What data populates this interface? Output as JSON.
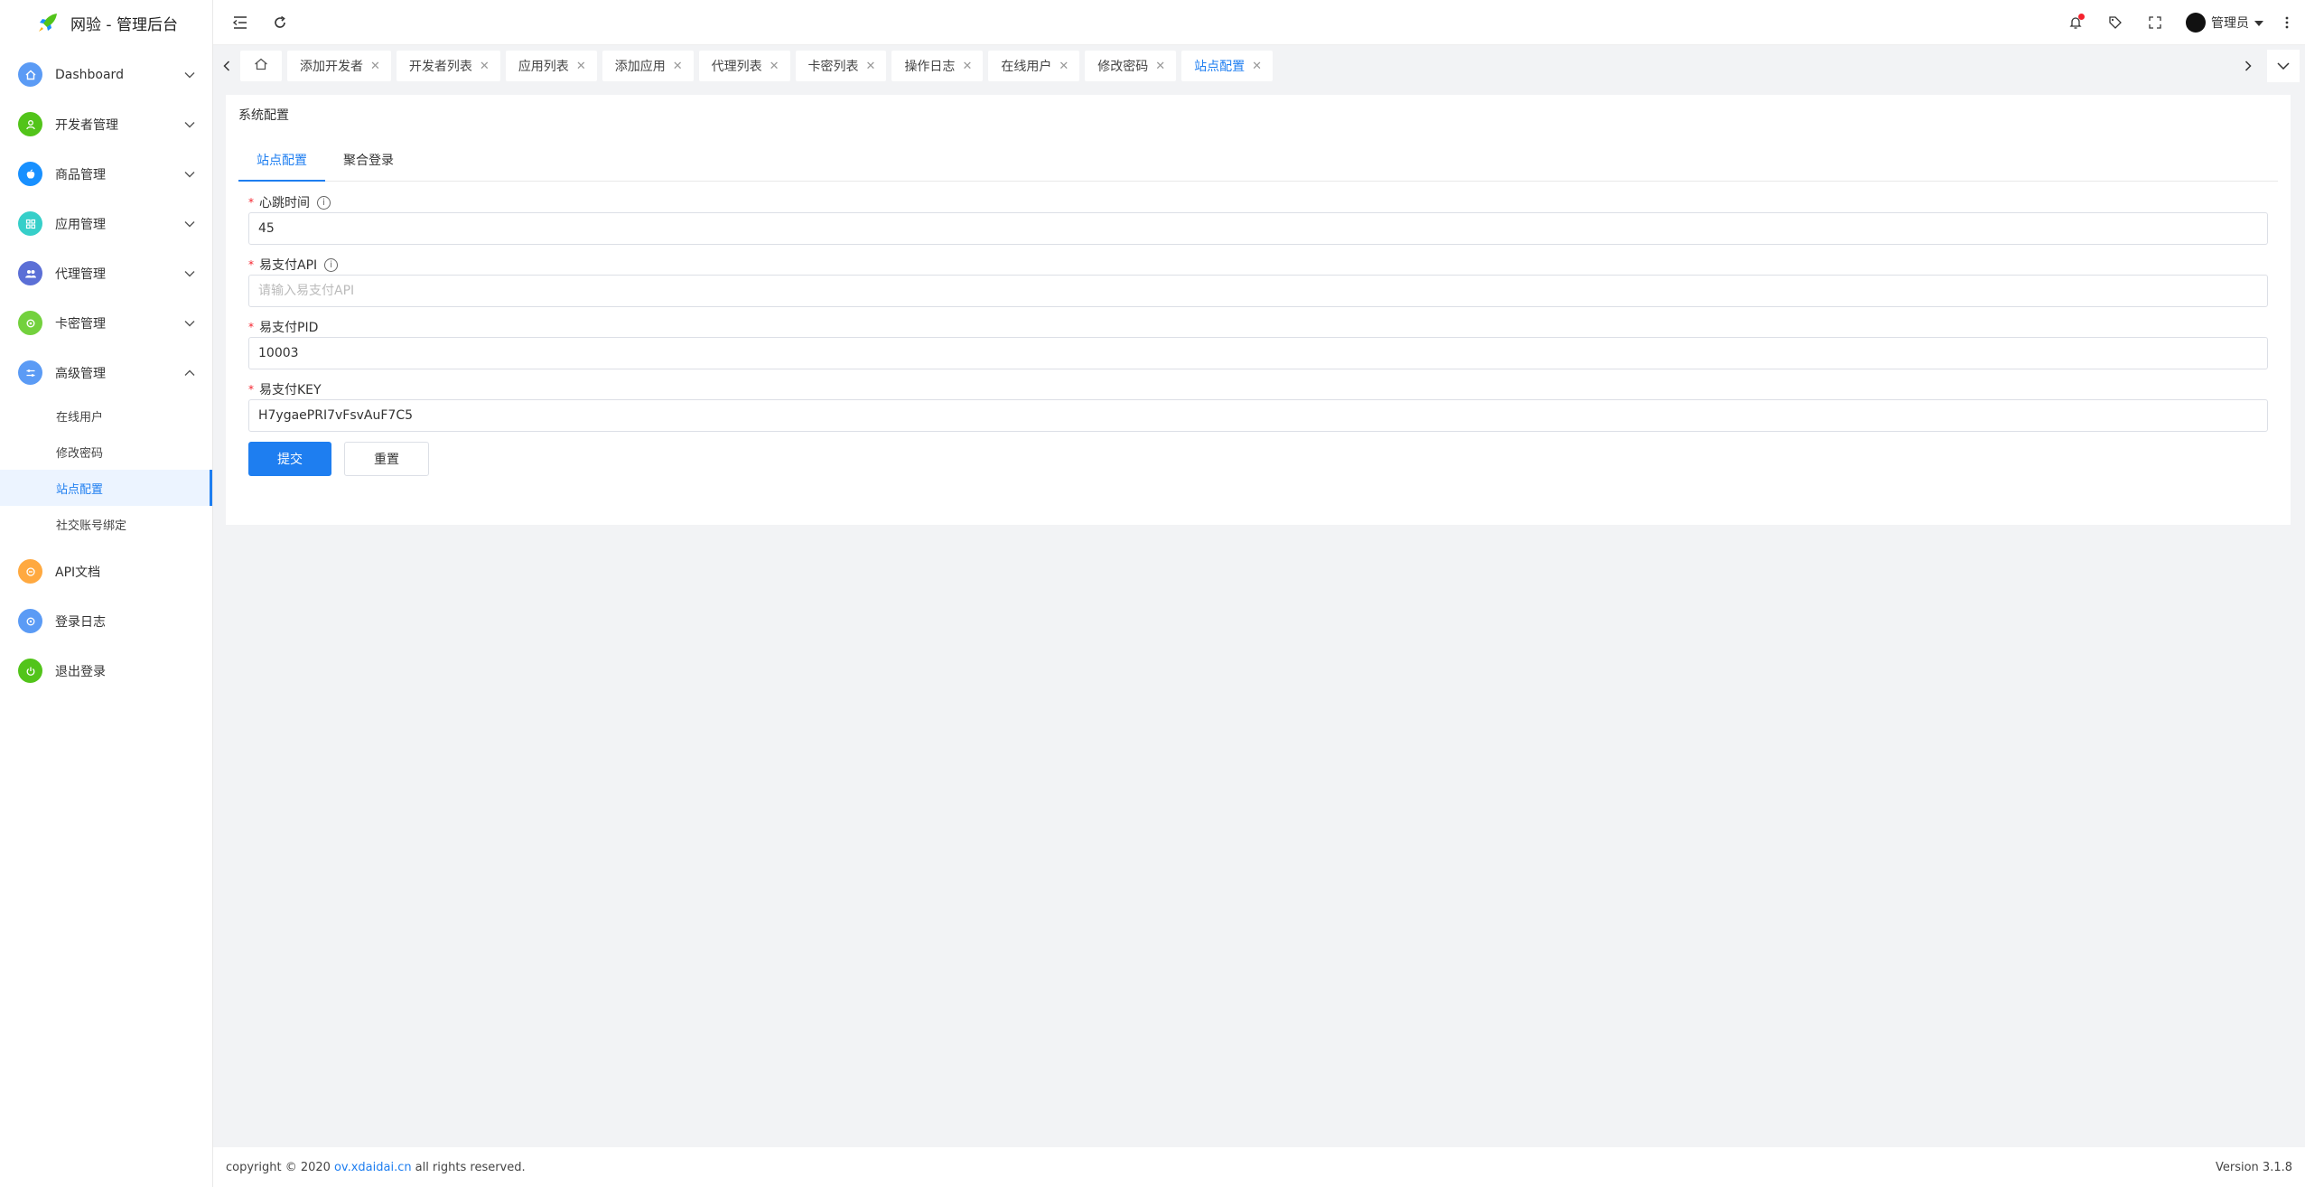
{
  "app": {
    "title": "网验 - 管理后台"
  },
  "colors": {
    "accent": "#1e7ef0",
    "danger": "#f5222d"
  },
  "sidebar": {
    "items": [
      {
        "label": "Dashboard",
        "icon": "home-icon",
        "color": "#5b9bf5"
      },
      {
        "label": "开发者管理",
        "icon": "user-icon",
        "color": "#52c41a"
      },
      {
        "label": "商品管理",
        "icon": "apple-icon",
        "color": "#1890ff"
      },
      {
        "label": "应用管理",
        "icon": "grid-icon",
        "color": "#36cfc9"
      },
      {
        "label": "代理管理",
        "icon": "users-icon",
        "color": "#5b6fd6"
      },
      {
        "label": "卡密管理",
        "icon": "gear-icon",
        "color": "#73d13d"
      },
      {
        "label": "高级管理",
        "icon": "sliders-icon",
        "color": "#5b9bf5"
      }
    ],
    "submenu": [
      "在线用户",
      "修改密码",
      "站点配置",
      "社交账号绑定"
    ],
    "bottom": [
      {
        "label": "API文档",
        "icon": "doc-icon",
        "color": "#ffa940"
      },
      {
        "label": "登录日志",
        "icon": "log-icon",
        "color": "#5b9bf5"
      },
      {
        "label": "退出登录",
        "icon": "power-icon",
        "color": "#52c41a"
      }
    ]
  },
  "header": {
    "user": "管理员"
  },
  "tabs": [
    "添加开发者",
    "开发者列表",
    "应用列表",
    "添加应用",
    "代理列表",
    "卡密列表",
    "操作日志",
    "在线用户",
    "修改密码",
    "站点配置"
  ],
  "card": {
    "title": "系统配置",
    "tabs": [
      "站点配置",
      "聚合登录"
    ],
    "fields": [
      {
        "label": "心跳时间",
        "value": "45",
        "placeholder": ""
      },
      {
        "label": "易支付API",
        "value": "",
        "placeholder": "请输入易支付API"
      },
      {
        "label": "易支付PID",
        "value": "10003",
        "placeholder": ""
      },
      {
        "label": "易支付KEY",
        "value": "H7ygaePRI7vFsvAuF7C5",
        "placeholder": ""
      }
    ],
    "submit": "提交",
    "reset": "重置"
  },
  "footer": {
    "prefix": "copyright © 2020",
    "link": "ov.xdaidai.cn",
    "suffix": "all rights reserved.",
    "version": "Version 3.1.8"
  }
}
